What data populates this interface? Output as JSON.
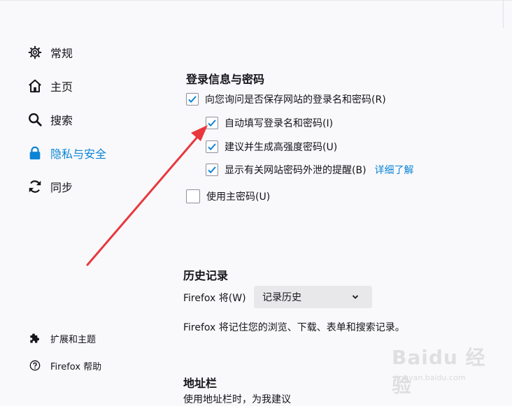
{
  "sidebar": {
    "items": [
      {
        "label": "常规",
        "icon": "gear-icon"
      },
      {
        "label": "主页",
        "icon": "home-icon"
      },
      {
        "label": "搜索",
        "icon": "search-icon"
      },
      {
        "label": "隐私与安全",
        "icon": "lock-icon",
        "active": true
      },
      {
        "label": "同步",
        "icon": "sync-icon"
      }
    ],
    "footer": [
      {
        "label": "扩展和主题",
        "icon": "puzzle-icon"
      },
      {
        "label": "Firefox 帮助",
        "icon": "help-icon"
      }
    ]
  },
  "logins": {
    "heading": "登录信息与密码",
    "ask_save": {
      "label": "向您询问是否保存网站的登录名和密码(R)",
      "checked": true
    },
    "autofill": {
      "label": "自动填写登录名和密码(I)",
      "checked": true
    },
    "suggest": {
      "label": "建议并生成高强度密码(U)",
      "checked": true
    },
    "breach_alerts": {
      "label": "显示有关网站密码外泄的提醒(B)",
      "checked": true,
      "link": "详细了解"
    },
    "primary_password": {
      "label": "使用主密码(U)",
      "checked": false
    }
  },
  "history": {
    "heading": "历史记录",
    "will_label": "Firefox 将(W)",
    "select_value": "记录历史",
    "description": "Firefox 将记住您的浏览、下载、表单和搜索记录。"
  },
  "address_bar": {
    "heading": "地址栏",
    "partial_text": "使用地址栏时，为我建议"
  },
  "watermark": {
    "brand": "Baidu 经验",
    "url": "jingyan.baidu.com"
  },
  "colors": {
    "accent": "#0a84d6",
    "annotation_arrow": "#e8383d",
    "background": "#f9f9fb"
  }
}
